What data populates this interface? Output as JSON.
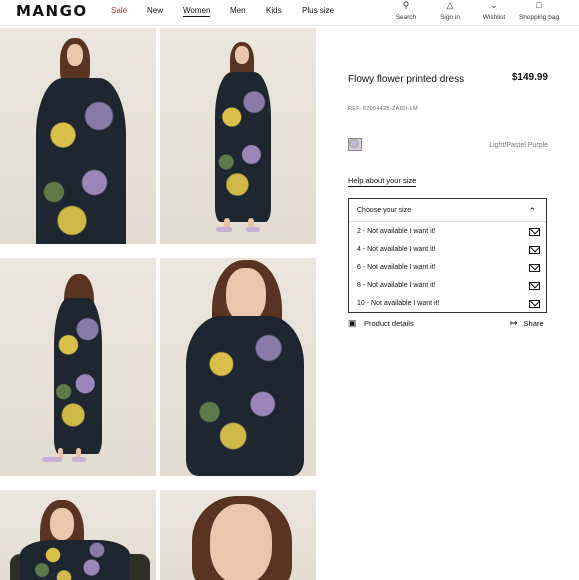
{
  "header": {
    "logo": "MANGO",
    "nav": [
      {
        "label": "Sale"
      },
      {
        "label": "New"
      },
      {
        "label": "Women"
      },
      {
        "label": "Men"
      },
      {
        "label": "Kids"
      },
      {
        "label": "Plus size"
      }
    ],
    "utilities": [
      {
        "label": "Search",
        "icon": "search-icon"
      },
      {
        "label": "Sign in",
        "icon": "user-icon"
      },
      {
        "label": "Wishlist",
        "icon": "heart-icon"
      },
      {
        "label": "Shopping bag",
        "icon": "bag-icon"
      }
    ]
  },
  "product": {
    "title": "Flowy flower printed dress",
    "price": "$149.99",
    "ref": "REF. 67054425-ZAIDI-LM",
    "color": "Light/Pastel Purple",
    "size_help": "Help about your size",
    "size_select": {
      "label": "Choose your size",
      "options": [
        "2 - Not available I want it!",
        "4 - Not available I want it!",
        "6 - Not available I want it!",
        "8 - Not available I want it!",
        "10 - Not available I want it!"
      ]
    },
    "details_label": "Product details",
    "share_label": "Share"
  },
  "colors": {
    "sale": "#c0392b",
    "text": "#111111"
  }
}
